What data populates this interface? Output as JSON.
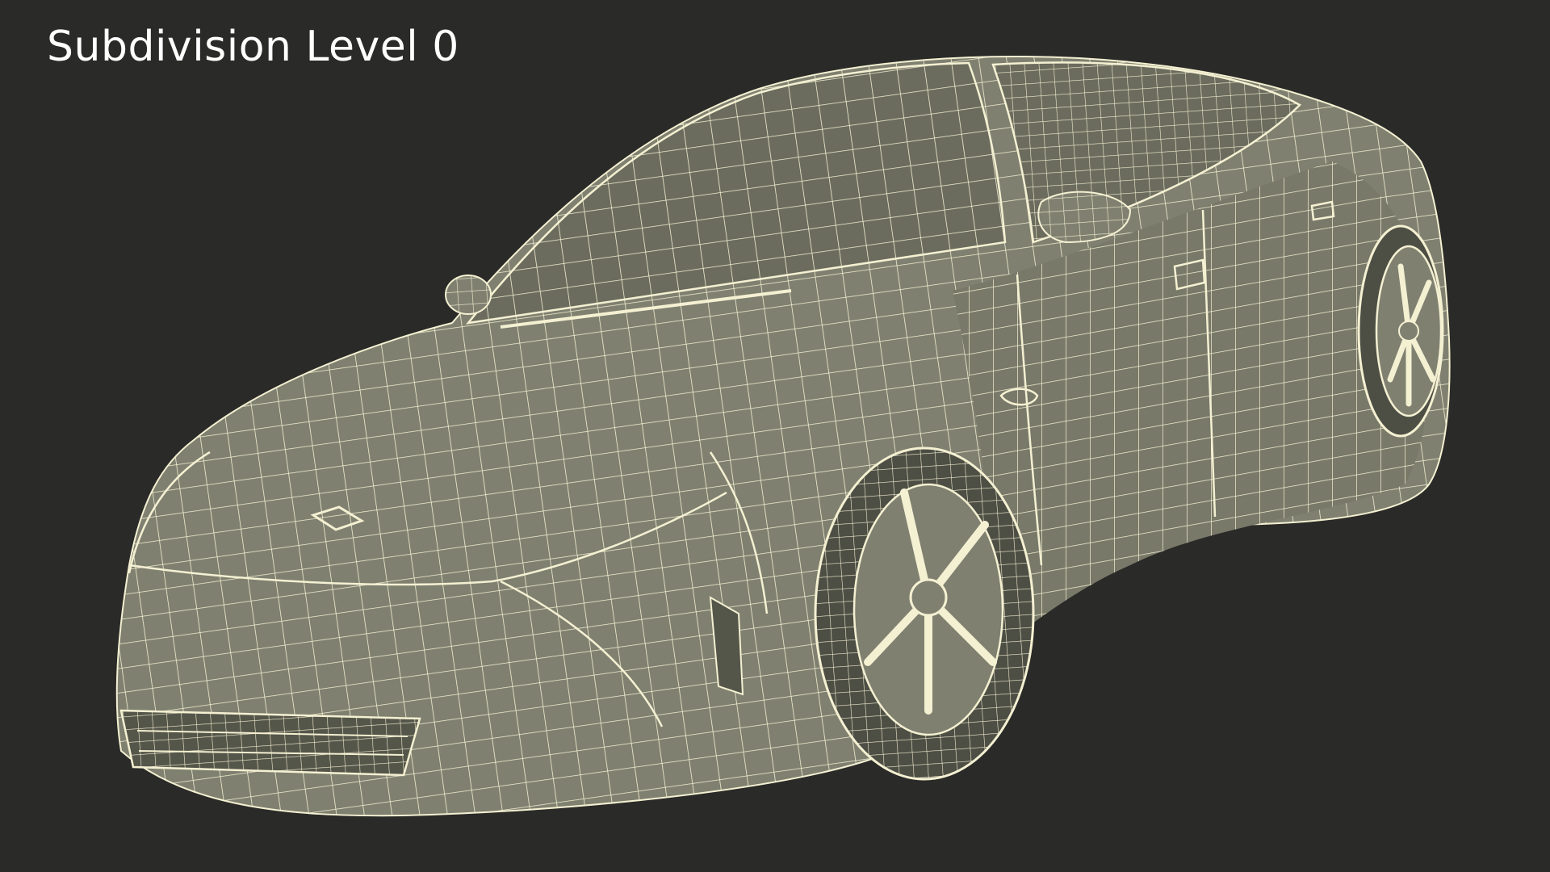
{
  "viewport": {
    "caption": "Subdivision Level 0"
  },
  "colors": {
    "background": "#2a2a28",
    "body": "#7f8070",
    "body_shade": "#6b6c5e",
    "wire": "#f4f0d2",
    "caption": "#ffffff"
  }
}
